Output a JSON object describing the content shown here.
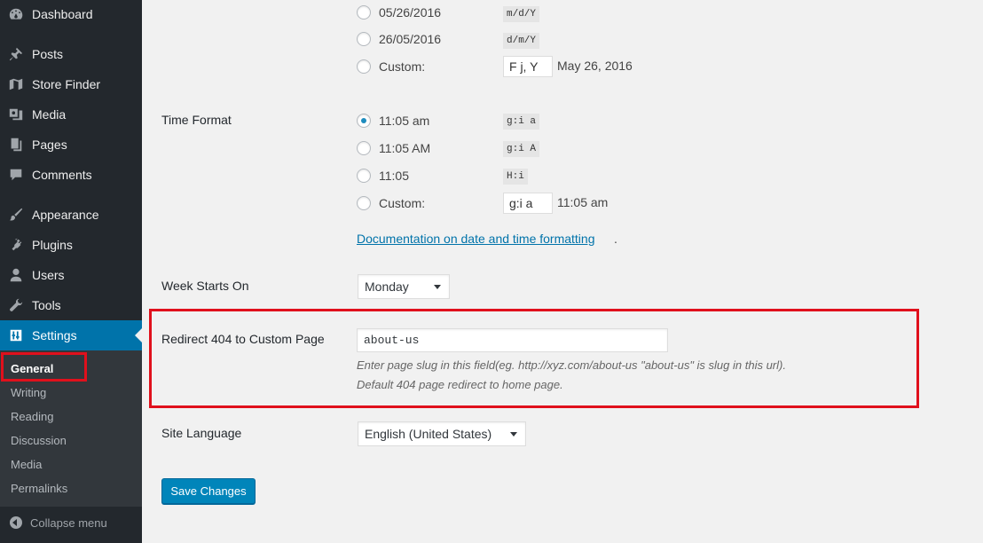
{
  "sidebar": {
    "items": [
      {
        "label": "Dashboard",
        "icon": "dashboard-icon"
      },
      {
        "label": "Posts",
        "icon": "pin-icon"
      },
      {
        "label": "Store Finder",
        "icon": "map-icon"
      },
      {
        "label": "Media",
        "icon": "media-icon"
      },
      {
        "label": "Pages",
        "icon": "pages-icon"
      },
      {
        "label": "Comments",
        "icon": "comment-icon"
      },
      {
        "label": "Appearance",
        "icon": "brush-icon"
      },
      {
        "label": "Plugins",
        "icon": "plug-icon"
      },
      {
        "label": "Users",
        "icon": "user-icon"
      },
      {
        "label": "Tools",
        "icon": "wrench-icon"
      },
      {
        "label": "Settings",
        "icon": "settings-icon",
        "active": true
      }
    ],
    "submenu": [
      "General",
      "Writing",
      "Reading",
      "Discussion",
      "Media",
      "Permalinks"
    ],
    "collapse_label": "Collapse menu"
  },
  "date_format": {
    "options": [
      {
        "label": "05/26/2016",
        "code": "m/d/Y"
      },
      {
        "label": "26/05/2016",
        "code": "d/m/Y"
      }
    ],
    "custom_label": "Custom:",
    "custom_value": "F j, Y",
    "custom_example": "May 26, 2016"
  },
  "time_format": {
    "label": "Time Format",
    "options": [
      {
        "label": "11:05 am",
        "code": "g:i a",
        "checked": true
      },
      {
        "label": "11:05 AM",
        "code": "g:i A"
      },
      {
        "label": "11:05",
        "code": "H:i"
      }
    ],
    "custom_label": "Custom:",
    "custom_value": "g:i a",
    "custom_example": "11:05 am",
    "doc_link": "Documentation on date and time formatting",
    "doc_suffix": "."
  },
  "week_starts": {
    "label": "Week Starts On",
    "value": "Monday"
  },
  "redirect": {
    "label": "Redirect 404 to Custom Page",
    "value": "about-us",
    "desc1": "Enter page slug in this field(eg. http://xyz.com/about-us \"about-us\" is slug in this url).",
    "desc2": "Default 404 page redirect to home page."
  },
  "site_language": {
    "label": "Site Language",
    "value": "English (United States)"
  },
  "save_label": "Save Changes",
  "colors": {
    "accent": "#0073aa",
    "highlight": "#e0101c",
    "sidebar": "#23282d"
  }
}
